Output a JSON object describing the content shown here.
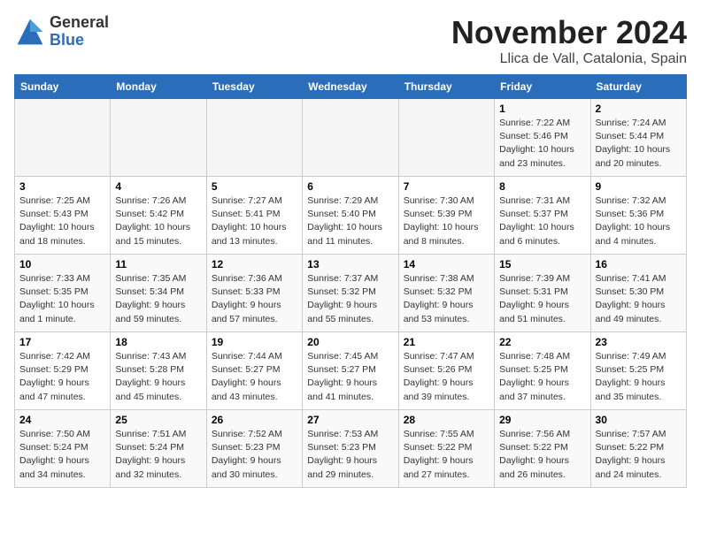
{
  "header": {
    "logo_general": "General",
    "logo_blue": "Blue",
    "month_title": "November 2024",
    "location": "Llica de Vall, Catalonia, Spain"
  },
  "calendar": {
    "days_of_week": [
      "Sunday",
      "Monday",
      "Tuesday",
      "Wednesday",
      "Thursday",
      "Friday",
      "Saturday"
    ],
    "weeks": [
      [
        {
          "day": "",
          "info": ""
        },
        {
          "day": "",
          "info": ""
        },
        {
          "day": "",
          "info": ""
        },
        {
          "day": "",
          "info": ""
        },
        {
          "day": "",
          "info": ""
        },
        {
          "day": "1",
          "info": "Sunrise: 7:22 AM\nSunset: 5:46 PM\nDaylight: 10 hours and 23 minutes."
        },
        {
          "day": "2",
          "info": "Sunrise: 7:24 AM\nSunset: 5:44 PM\nDaylight: 10 hours and 20 minutes."
        }
      ],
      [
        {
          "day": "3",
          "info": "Sunrise: 7:25 AM\nSunset: 5:43 PM\nDaylight: 10 hours and 18 minutes."
        },
        {
          "day": "4",
          "info": "Sunrise: 7:26 AM\nSunset: 5:42 PM\nDaylight: 10 hours and 15 minutes."
        },
        {
          "day": "5",
          "info": "Sunrise: 7:27 AM\nSunset: 5:41 PM\nDaylight: 10 hours and 13 minutes."
        },
        {
          "day": "6",
          "info": "Sunrise: 7:29 AM\nSunset: 5:40 PM\nDaylight: 10 hours and 11 minutes."
        },
        {
          "day": "7",
          "info": "Sunrise: 7:30 AM\nSunset: 5:39 PM\nDaylight: 10 hours and 8 minutes."
        },
        {
          "day": "8",
          "info": "Sunrise: 7:31 AM\nSunset: 5:37 PM\nDaylight: 10 hours and 6 minutes."
        },
        {
          "day": "9",
          "info": "Sunrise: 7:32 AM\nSunset: 5:36 PM\nDaylight: 10 hours and 4 minutes."
        }
      ],
      [
        {
          "day": "10",
          "info": "Sunrise: 7:33 AM\nSunset: 5:35 PM\nDaylight: 10 hours and 1 minute."
        },
        {
          "day": "11",
          "info": "Sunrise: 7:35 AM\nSunset: 5:34 PM\nDaylight: 9 hours and 59 minutes."
        },
        {
          "day": "12",
          "info": "Sunrise: 7:36 AM\nSunset: 5:33 PM\nDaylight: 9 hours and 57 minutes."
        },
        {
          "day": "13",
          "info": "Sunrise: 7:37 AM\nSunset: 5:32 PM\nDaylight: 9 hours and 55 minutes."
        },
        {
          "day": "14",
          "info": "Sunrise: 7:38 AM\nSunset: 5:32 PM\nDaylight: 9 hours and 53 minutes."
        },
        {
          "day": "15",
          "info": "Sunrise: 7:39 AM\nSunset: 5:31 PM\nDaylight: 9 hours and 51 minutes."
        },
        {
          "day": "16",
          "info": "Sunrise: 7:41 AM\nSunset: 5:30 PM\nDaylight: 9 hours and 49 minutes."
        }
      ],
      [
        {
          "day": "17",
          "info": "Sunrise: 7:42 AM\nSunset: 5:29 PM\nDaylight: 9 hours and 47 minutes."
        },
        {
          "day": "18",
          "info": "Sunrise: 7:43 AM\nSunset: 5:28 PM\nDaylight: 9 hours and 45 minutes."
        },
        {
          "day": "19",
          "info": "Sunrise: 7:44 AM\nSunset: 5:27 PM\nDaylight: 9 hours and 43 minutes."
        },
        {
          "day": "20",
          "info": "Sunrise: 7:45 AM\nSunset: 5:27 PM\nDaylight: 9 hours and 41 minutes."
        },
        {
          "day": "21",
          "info": "Sunrise: 7:47 AM\nSunset: 5:26 PM\nDaylight: 9 hours and 39 minutes."
        },
        {
          "day": "22",
          "info": "Sunrise: 7:48 AM\nSunset: 5:25 PM\nDaylight: 9 hours and 37 minutes."
        },
        {
          "day": "23",
          "info": "Sunrise: 7:49 AM\nSunset: 5:25 PM\nDaylight: 9 hours and 35 minutes."
        }
      ],
      [
        {
          "day": "24",
          "info": "Sunrise: 7:50 AM\nSunset: 5:24 PM\nDaylight: 9 hours and 34 minutes."
        },
        {
          "day": "25",
          "info": "Sunrise: 7:51 AM\nSunset: 5:24 PM\nDaylight: 9 hours and 32 minutes."
        },
        {
          "day": "26",
          "info": "Sunrise: 7:52 AM\nSunset: 5:23 PM\nDaylight: 9 hours and 30 minutes."
        },
        {
          "day": "27",
          "info": "Sunrise: 7:53 AM\nSunset: 5:23 PM\nDaylight: 9 hours and 29 minutes."
        },
        {
          "day": "28",
          "info": "Sunrise: 7:55 AM\nSunset: 5:22 PM\nDaylight: 9 hours and 27 minutes."
        },
        {
          "day": "29",
          "info": "Sunrise: 7:56 AM\nSunset: 5:22 PM\nDaylight: 9 hours and 26 minutes."
        },
        {
          "day": "30",
          "info": "Sunrise: 7:57 AM\nSunset: 5:22 PM\nDaylight: 9 hours and 24 minutes."
        }
      ]
    ]
  }
}
